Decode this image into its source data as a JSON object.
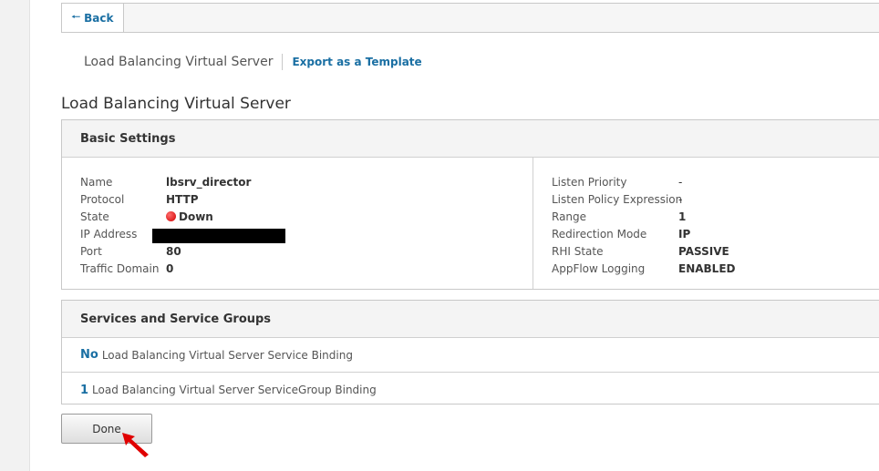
{
  "nav": {
    "back_label": "Back"
  },
  "breadcrumb": {
    "title": "Load Balancing Virtual Server",
    "export_link": "Export as a Template"
  },
  "page": {
    "title": "Load Balancing Virtual Server"
  },
  "basic_settings": {
    "header": "Basic Settings",
    "left": [
      {
        "key": "Name",
        "value": "lbsrv_director"
      },
      {
        "key": "Protocol",
        "value": "HTTP"
      },
      {
        "key": "State",
        "value": "Down"
      },
      {
        "key": "IP Address",
        "value": ""
      },
      {
        "key": "Port",
        "value": "80"
      },
      {
        "key": "Traffic Domain",
        "value": "0"
      }
    ],
    "right": [
      {
        "key": "Listen Priority",
        "value": "-"
      },
      {
        "key": "Listen Policy Expression",
        "value": "-"
      },
      {
        "key": "Range",
        "value": "1"
      },
      {
        "key": "Redirection Mode",
        "value": "IP"
      },
      {
        "key": "RHI State",
        "value": "PASSIVE"
      },
      {
        "key": "AppFlow Logging",
        "value": "ENABLED"
      }
    ]
  },
  "services": {
    "header": "Services and Service Groups",
    "rows": [
      {
        "count": "No",
        "label": "Load Balancing Virtual Server Service Binding"
      },
      {
        "count": "1",
        "label": "Load Balancing Virtual Server ServiceGroup Binding"
      }
    ]
  },
  "actions": {
    "done_label": "Done"
  },
  "colors": {
    "link": "#1a6fa3",
    "state_down": "#d00000",
    "pointer": "#e00000"
  }
}
